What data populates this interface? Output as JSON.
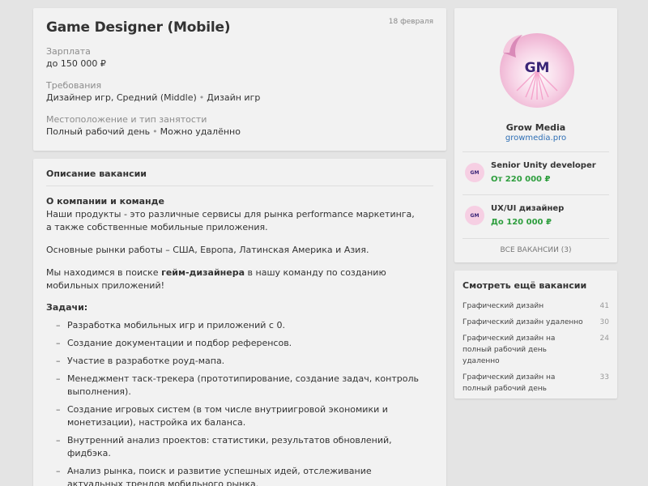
{
  "job": {
    "title": "Game Designer (Mobile)",
    "date": "18 февраля",
    "salary_label": "Зарплата",
    "salary_value": "до 150 000 ₽",
    "requirements_label": "Требования",
    "requirements": [
      "Дизайнер игр, Средний (Middle)",
      "Дизайн игр"
    ],
    "location_label": "Местоположение и тип занятости",
    "location": [
      "Полный рабочий день",
      "Можно удалённо"
    ]
  },
  "description": {
    "title": "Описание вакансии",
    "about_heading": "О компании и команде",
    "p1": "Наши продукты - это различные сервисы для рынка performance маркетинга, а также собственные мобильные приложения.",
    "p2": "Основные рынки работы – США, Европа, Латинская Америка и Азия.",
    "p3_before": "Мы находимся в поиске ",
    "p3_bold": "гейм-дизайнера",
    "p3_after": " в нашу команду по созданию мобильных приложений!",
    "tasks_heading": "Задачи:",
    "tasks": [
      "Разработка мобильных игр и приложений с 0.",
      "Создание документации и подбор референсов.",
      "Участие в разработке роуд-мапа.",
      "Менеджмент таск-трекера (прототипирование, создание задач, контроль выполнения).",
      "Создание игровых систем (в том числе внутриигровой экономики и монетизации), настройка их баланса.",
      "Внутренний анализ проектов: статистики, результатов обновлений, фидбэка.",
      "Анализ рынка, поиск и развитие успешных идей, отслеживание актуальных трендов мобильного рынка."
    ]
  },
  "company": {
    "name": "Grow Media",
    "site": "growmedia.pro",
    "logo_text": "GM",
    "vacancies": [
      {
        "title": "Senior Unity developer",
        "salary": "От 220 000 ₽"
      },
      {
        "title": "UX/UI дизайнер",
        "salary": "До 120 000 ₽"
      }
    ],
    "all_vacancies": "ВСЕ ВАКАНСИИ (3)"
  },
  "similar": {
    "title": "Смотреть ещё вакансии",
    "items": [
      {
        "label": "Графический дизайн",
        "count": "41"
      },
      {
        "label": "Графический дизайн удаленно",
        "count": "30"
      },
      {
        "label": "Графический дизайн на полный рабочий день удаленно",
        "count": "24"
      },
      {
        "label": "Графический дизайн на полный рабочий день",
        "count": "33"
      }
    ]
  },
  "colors": {
    "accent_link": "#2f6fb5",
    "salary_green": "#2e9e3e",
    "logo_pink": "#f4c4dc"
  }
}
